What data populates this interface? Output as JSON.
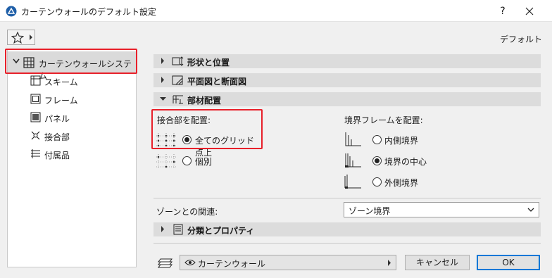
{
  "window": {
    "title": "カーテンウォールのデフォルト設定",
    "help_label": "?",
    "close_label": "✕"
  },
  "header": {
    "favorites_icon": "star-icon",
    "default_label": "デフォルト"
  },
  "tree": {
    "root_label": "カーテンウォールシステム",
    "items": [
      {
        "label": "スキーム",
        "icon": "scheme-icon"
      },
      {
        "label": "フレーム",
        "icon": "frame-icon"
      },
      {
        "label": "パネル",
        "icon": "panel-icon"
      },
      {
        "label": "接合部",
        "icon": "junction-icon"
      },
      {
        "label": "付属品",
        "icon": "accessory-icon"
      }
    ]
  },
  "sections": {
    "shape": "形状と位置",
    "plan": "平面図と断面図",
    "placement": "部材配置",
    "classification": "分類とプロパティ"
  },
  "placement": {
    "junction_heading": "接合部を配置:",
    "junction_options": [
      {
        "label": "全てのグリッド点上",
        "selected": true
      },
      {
        "label": "個別",
        "selected": false
      }
    ],
    "boundary_heading": "境界フレームを配置:",
    "boundary_options": [
      {
        "label": "内側境界",
        "selected": false
      },
      {
        "label": "境界の中心",
        "selected": true
      },
      {
        "label": "外側境界",
        "selected": false
      }
    ]
  },
  "zone": {
    "label": "ゾーンとの関連:",
    "value": "ゾーン境界"
  },
  "footer": {
    "layer_value": "カーテンウォール",
    "cancel_label": "キャンセル",
    "ok_label": "OK"
  },
  "colors": {
    "highlight": "#e8202a",
    "primary_button_border": "#0078d7"
  }
}
